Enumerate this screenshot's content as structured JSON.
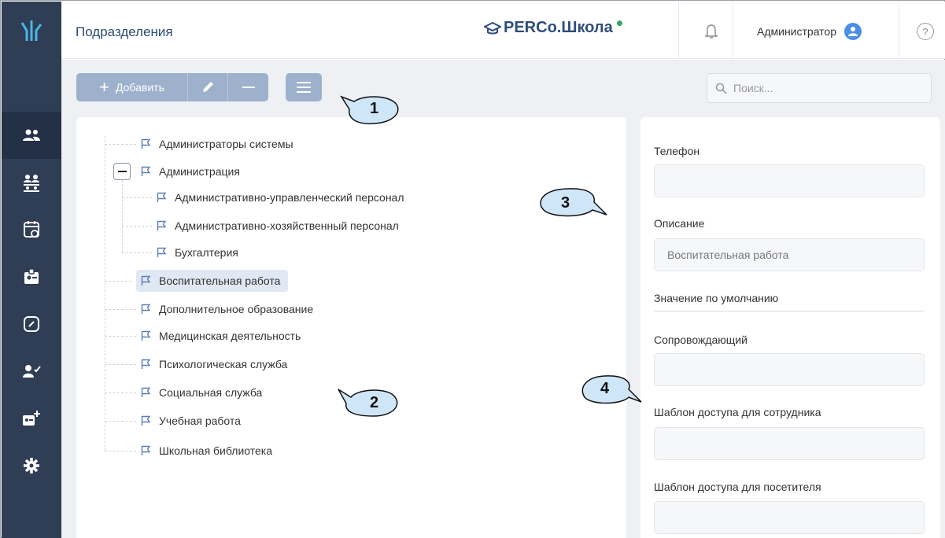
{
  "header": {
    "page_title": "Подразделения",
    "brand": "PERCo.Школа",
    "user_name": "Администратор",
    "help_label": "?"
  },
  "toolbar": {
    "add_label": "Добавить"
  },
  "search": {
    "placeholder": "Поиск..."
  },
  "sidebar": {
    "items": [
      {
        "icon": "departments-icon",
        "active": true
      },
      {
        "icon": "groups-icon"
      },
      {
        "icon": "calendar-icon"
      },
      {
        "icon": "badge-icon"
      },
      {
        "icon": "link-icon"
      },
      {
        "icon": "user-check-icon"
      },
      {
        "icon": "add-card-icon"
      },
      {
        "icon": "gear-icon"
      }
    ]
  },
  "tree": {
    "items": [
      {
        "label": "Администраторы системы",
        "level": 0
      },
      {
        "label": "Администрация",
        "level": 0,
        "expanded": true
      },
      {
        "label": "Административно-управленческий персонал",
        "level": 1
      },
      {
        "label": "Административно-хозяйственный персонал",
        "level": 1
      },
      {
        "label": "Бухгалтерия",
        "level": 1
      },
      {
        "label": "Воспитательная работа",
        "level": 0,
        "selected": true
      },
      {
        "label": "Дополнительное образование",
        "level": 0
      },
      {
        "label": "Медицинская деятельность",
        "level": 0
      },
      {
        "label": "Психологическая служба",
        "level": 0
      },
      {
        "label": "Социальная служба",
        "level": 0
      },
      {
        "label": "Учебная работа",
        "level": 0
      },
      {
        "label": "Школьная библиотека",
        "level": 0
      }
    ]
  },
  "properties": {
    "phone_label": "Телефон",
    "phone_value": "",
    "description_label": "Описание",
    "description_value": "Воспитательная работа",
    "default_label": "Значение по умолчанию",
    "escort_label": "Сопровождающий",
    "escort_value": "",
    "employee_template_label": "Шаблон доступа для сотрудника",
    "employee_template_value": "",
    "visitor_template_label": "Шаблон доступа для посетителя",
    "visitor_template_value": ""
  },
  "callouts": [
    "1",
    "2",
    "3",
    "4"
  ],
  "colors": {
    "sidebar_bg": "#2f3d55",
    "accent": "#4a8ee8",
    "button_bg": "#9db1cc",
    "brand_text": "#2e4d7a",
    "status_dot": "#3aa35a",
    "callout_fill": "#cfe6f8"
  }
}
